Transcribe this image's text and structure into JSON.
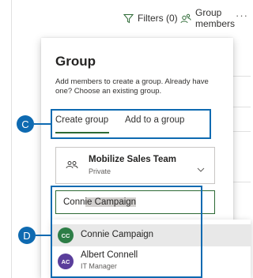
{
  "toolbar": {
    "filters_label": "Filters (0)",
    "group_members_label": "Group members",
    "more_label": "···",
    "filter_icon": "funnel-icon",
    "members_icon": "people-icon"
  },
  "panel": {
    "title": "Group",
    "description": "Add members to create a group. Already have one? Choose an existing group.",
    "tabs": [
      {
        "label": "Create group",
        "selected": true
      },
      {
        "label": "Add to a group",
        "selected": false
      }
    ],
    "group_select": {
      "name": "Mobilize Sales Team",
      "privacy": "Private",
      "icon": "group-icon"
    },
    "member_input": {
      "value_prefix": "Conn",
      "value_selected": "ie Campaign"
    }
  },
  "suggestions": [
    {
      "initials": "CC",
      "name": "Connie Campaign",
      "title": "",
      "avatar_color": "#2d7d46",
      "highlighted": true
    },
    {
      "initials": "AC",
      "name": "Albert Connell",
      "title": "IT Manager",
      "avatar_color": "#5a3e9b",
      "highlighted": false
    }
  ],
  "callouts": {
    "c": "C",
    "d": "D",
    "color": "#0e6ab1"
  },
  "accent_color": "#2d6a35"
}
